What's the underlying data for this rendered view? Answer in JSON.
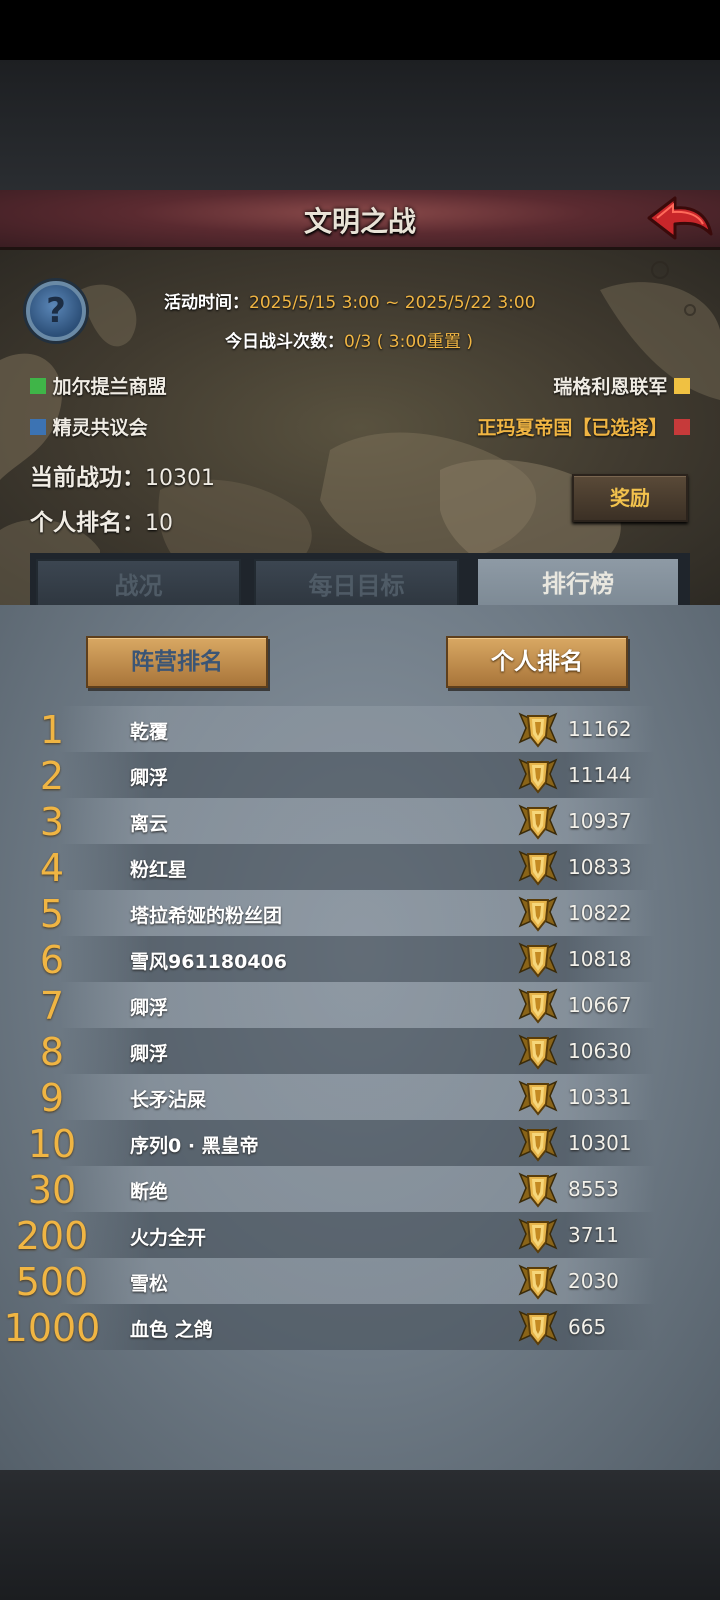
{
  "header": {
    "title": "文明之战",
    "back_icon": "red-arrow-back-icon",
    "help_icon": "question-mark-icon",
    "help_glyph": "?"
  },
  "event": {
    "time_label": "活动时间：",
    "time_value": "2025/5/15 3:00 ~ 2025/5/22 3:00",
    "battles_label": "今日战斗次数：",
    "battles_value": "0/3 ( 3:00重置 )"
  },
  "factions": [
    {
      "name": "加尔提兰商盟",
      "color": "#3fb548"
    },
    {
      "name": "精灵共议会",
      "color": "#3c73b3"
    },
    {
      "name": "瑞格利恩联军",
      "color": "#f0c142"
    },
    {
      "name": "正玛夏帝国【已选择】",
      "color": "#c63a3a"
    }
  ],
  "stats": {
    "merit_label": "当前战功：",
    "merit_value": "10301",
    "rank_label": "个人排名：",
    "rank_value": "10",
    "reward_button": "奖励"
  },
  "tabs": [
    {
      "label": "战况",
      "active": false
    },
    {
      "label": "每日目标",
      "active": false
    },
    {
      "label": "排行榜",
      "active": true
    }
  ],
  "ranking_tabs": {
    "faction": "阵营排名",
    "personal": "个人排名",
    "active": "personal"
  },
  "medal_icon": "gold-shield-medal-icon",
  "leaderboard": [
    {
      "rank": "1",
      "name": "乾覆",
      "score": "11162"
    },
    {
      "rank": "2",
      "name": "卿浮",
      "score": "11144"
    },
    {
      "rank": "3",
      "name": "离云",
      "score": "10937"
    },
    {
      "rank": "4",
      "name": "粉红星",
      "score": "10833"
    },
    {
      "rank": "5",
      "name": "塔拉希娅的粉丝团",
      "score": "10822"
    },
    {
      "rank": "6",
      "name": "雪风961180406",
      "score": "10818"
    },
    {
      "rank": "7",
      "name": "卿浮",
      "score": "10667"
    },
    {
      "rank": "8",
      "name": "卿浮",
      "score": "10630"
    },
    {
      "rank": "9",
      "name": "长矛沾屎",
      "score": "10331"
    },
    {
      "rank": "10",
      "name": "序列0 · 黑皇帝",
      "score": "10301"
    },
    {
      "rank": "30",
      "name": "断绝",
      "score": "8553"
    },
    {
      "rank": "200",
      "name": "火力全开",
      "score": "3711"
    },
    {
      "rank": "500",
      "name": "雪松",
      "score": "2030"
    },
    {
      "rank": "1000",
      "name": "血色 之鸽",
      "score": "665"
    }
  ]
}
